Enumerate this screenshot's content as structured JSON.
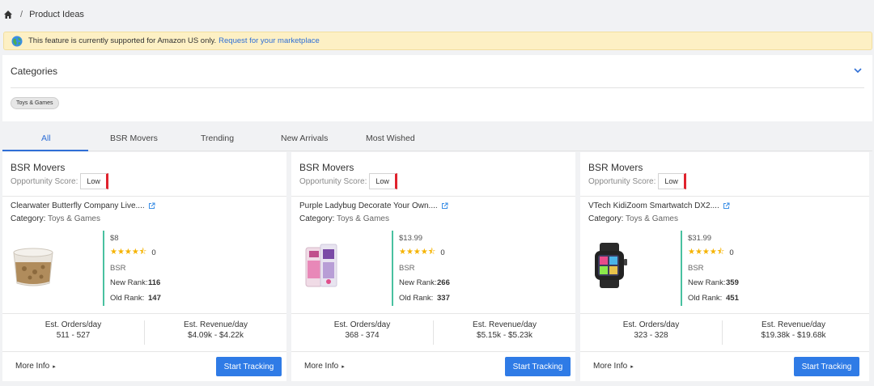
{
  "breadcrumb": {
    "home_icon": "home-icon",
    "separator": "/",
    "current": "Product Ideas"
  },
  "notice": {
    "icon": "globe-icon",
    "text": "This feature is currently supported for Amazon US only.",
    "link": "Request for your marketplace"
  },
  "categories": {
    "title": "Categories",
    "toggle_icon": "chevron-down-icon",
    "selected_tags": [
      "Toys & Games"
    ]
  },
  "tabs": [
    "All",
    "BSR Movers",
    "Trending",
    "New Arrivals",
    "Most Wished"
  ],
  "active_tab": "All",
  "cards": [
    {
      "section": "BSR Movers",
      "opportunity_label": "Opportunity Score:",
      "opportunity_value": "Low",
      "product_name": "Clearwater Butterfly Company Live....",
      "category_label": "Category:",
      "category_value": "Toys & Games",
      "price": "$8",
      "rating_stars": 4.5,
      "reviews": "0",
      "bsr_label": "BSR",
      "new_rank_label": "New Rank:",
      "new_rank": "116",
      "old_rank_label": "Old Rank:",
      "old_rank": "147",
      "orders_label": "Est. Orders/day",
      "orders": "511 - 527",
      "revenue_label": "Est. Revenue/day",
      "revenue": "$4.09k - $4.22k",
      "more_label": "More Info",
      "track_label": "Start Tracking"
    },
    {
      "section": "BSR Movers",
      "opportunity_label": "Opportunity Score:",
      "opportunity_value": "Low",
      "product_name": "Purple Ladybug Decorate Your Own....",
      "category_label": "Category:",
      "category_value": "Toys & Games",
      "price": "$13.99",
      "rating_stars": 4.5,
      "reviews": "0",
      "bsr_label": "BSR",
      "new_rank_label": "New Rank:",
      "new_rank": "266",
      "old_rank_label": "Old Rank:",
      "old_rank": "337",
      "orders_label": "Est. Orders/day",
      "orders": "368 - 374",
      "revenue_label": "Est. Revenue/day",
      "revenue": "$5.15k - $5.23k",
      "more_label": "More Info",
      "track_label": "Start Tracking"
    },
    {
      "section": "BSR Movers",
      "opportunity_label": "Opportunity Score:",
      "opportunity_value": "Low",
      "product_name": "VTech KidiZoom Smartwatch DX2....",
      "category_label": "Category:",
      "category_value": "Toys & Games",
      "price": "$31.99",
      "rating_stars": 4.5,
      "reviews": "0",
      "bsr_label": "BSR",
      "new_rank_label": "New Rank:",
      "new_rank": "359",
      "old_rank_label": "Old Rank:",
      "old_rank": "451",
      "orders_label": "Est. Orders/day",
      "orders": "323 - 328",
      "revenue_label": "Est. Revenue/day",
      "revenue": "$19.38k - $19.68k",
      "more_label": "More Info",
      "track_label": "Start Tracking"
    }
  ],
  "colors": {
    "accent": "#2f7be6",
    "low_score": "#e0222d",
    "stats_bar": "#49c1a0",
    "star": "#f5b301",
    "notice_bg": "#fdf0c4"
  }
}
